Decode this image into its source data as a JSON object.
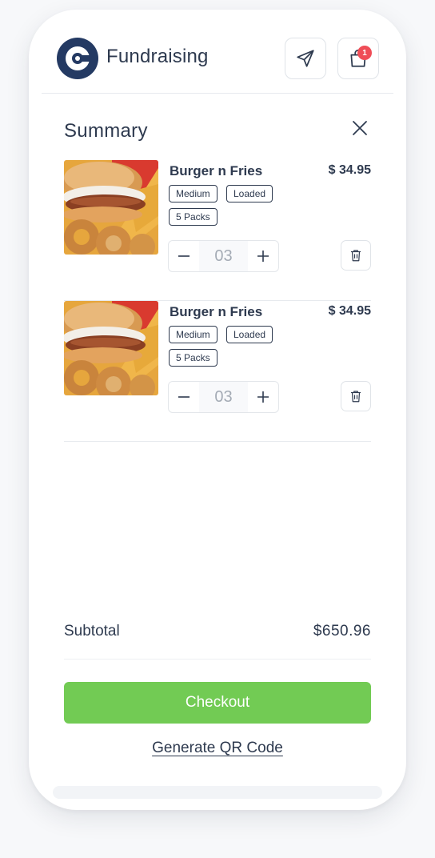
{
  "header": {
    "brand": "Fundraising",
    "cart_count": "1"
  },
  "summary": {
    "title": "Summary"
  },
  "items": [
    {
      "name": "Burger n Fries",
      "price": "$ 34.95",
      "tags": [
        "Medium",
        "Loaded",
        "5 Packs"
      ],
      "quantity": "03"
    },
    {
      "name": "Burger n Fries",
      "price": "$ 34.95",
      "tags": [
        "Medium",
        "Loaded",
        "5 Packs"
      ],
      "quantity": "03"
    }
  ],
  "subtotal": {
    "label": "Subtotal",
    "value": "$650.96"
  },
  "actions": {
    "checkout": "Checkout",
    "qr": "Generate QR Code"
  },
  "colors": {
    "brand": "#243a63",
    "accent_green": "#72cb54",
    "badge_red": "#ef4d57",
    "text": "#2e3a4f"
  },
  "icons": [
    "send-icon",
    "shopping-bag-icon",
    "close-icon",
    "minus-icon",
    "plus-icon",
    "trash-icon"
  ]
}
